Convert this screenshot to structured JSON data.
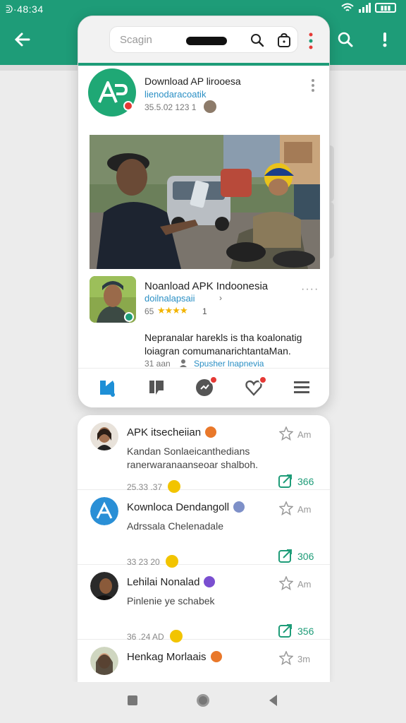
{
  "status": {
    "time": "ᕲ·48:34",
    "battery": "▮▮▮"
  },
  "colors": {
    "accent": "#1e9c78",
    "link": "#2a8fc4",
    "star": "#f2b400",
    "badge": "#e53935"
  },
  "browser": {
    "url_placeholder": "Scagin"
  },
  "card1": {
    "title": "Download AP lirooesa",
    "subtitle": "lienodaracoatik",
    "meta": "35.5.02 123  1"
  },
  "card2": {
    "title": "Noanload APK Indoonesia",
    "subtitle": "doilnalapsaii",
    "rating": "65",
    "stars": "★★★★",
    "rating_count": "1",
    "more": "····",
    "description": "Nepranalar harekls is tha koalonatig loiagran comumanarichtantaMan.",
    "time": "31 aan",
    "publisher": "Spusher lnapnevia"
  },
  "tabs": [
    {
      "name": "home"
    },
    {
      "name": "reviews"
    },
    {
      "name": "updates"
    },
    {
      "name": "wishlist"
    },
    {
      "name": "menu"
    }
  ],
  "comments": [
    {
      "title": "APK itsecheiian",
      "time": "Am",
      "text": "Kandan  Sonlaeicanthedians ranerwaranaanseoar shalboh.",
      "date": "25.33 .37",
      "count": "366",
      "emoji_color": "#e9782a"
    },
    {
      "title": "Kownloca Dendangoll",
      "time": "Am",
      "text": "Adrssala Chelenadale",
      "date": "33 23  20",
      "count": "306",
      "emoji_color": "#7e90c8"
    },
    {
      "title": "Lehilai Nonalad",
      "time": "Am",
      "text": "Pinlenie ye schabek",
      "date": "36 .24  AD",
      "count": "356",
      "emoji_color": "#7a4fd0"
    },
    {
      "title": "Henkag Morlaais",
      "time": "3m",
      "text": "",
      "date": "",
      "count": "",
      "emoji_color": "#e9782a"
    }
  ]
}
